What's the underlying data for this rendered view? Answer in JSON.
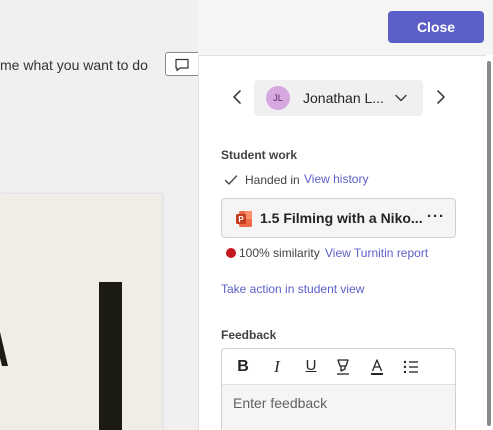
{
  "document": {
    "tell_me_text": "me what you want to do"
  },
  "header": {
    "close_label": "Close"
  },
  "student_nav": {
    "avatar_initials": "JL",
    "student_name": "Jonathan L..."
  },
  "student_work": {
    "title": "Student work",
    "status": "Handed in",
    "view_history_label": "View history",
    "file_name": "1.5 Filming with a Niko...",
    "more_label": "···",
    "similarity_text": "100% similarity",
    "turnitin_label": "View Turnitin report",
    "take_action_label": "Take action in student view"
  },
  "feedback": {
    "title": "Feedback",
    "bold_label": "B",
    "italic_label": "I",
    "underline_label": "U",
    "placeholder": "Enter feedback"
  },
  "colors": {
    "accent": "#5b5fc7",
    "similarity_dot": "#c4171f",
    "avatar_bg": "#d7a7e0"
  },
  "icons": [
    "chevron-left-icon",
    "chevron-right-icon",
    "chevron-down-icon",
    "checkmark-icon",
    "powerpoint-icon",
    "comment-icon",
    "highlight-icon",
    "font-color-icon",
    "bullet-list-icon"
  ]
}
